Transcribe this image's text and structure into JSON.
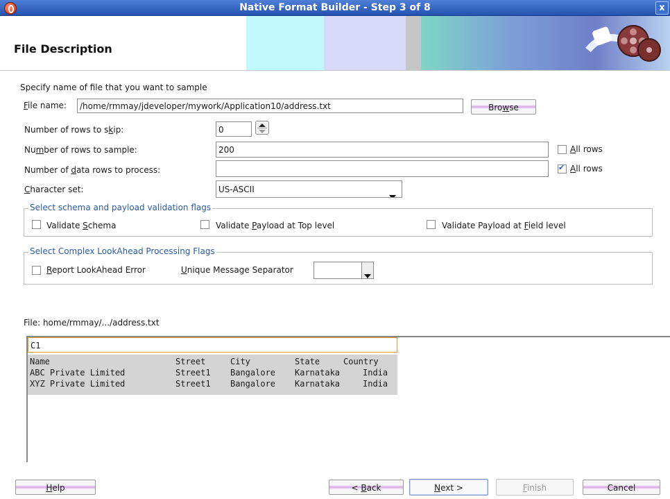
{
  "window": {
    "title": "Native Format Builder - Step 3 of 8",
    "close_label": "x"
  },
  "header": {
    "title": "File Description"
  },
  "form": {
    "intro": "Specify name of file that you want to sample",
    "file_name_label": "File name:",
    "file_name_value": "/home/rmmay/jdeveloper/mywork/Application10/address.txt",
    "browse_label": "Browse",
    "rows_to_skip_label": "Number of rows to skip:",
    "rows_to_skip_value": "0",
    "rows_to_sample_label": "Number of rows to sample:",
    "rows_to_sample_value": "200",
    "all_rows_label": "All rows",
    "all_rows_sample_checked": false,
    "data_rows_label": "Number of data rows to process:",
    "data_rows_value": "",
    "all_rows_process_checked": true,
    "charset_label": "Character set:",
    "charset_value": "US-ASCII"
  },
  "validation_group": {
    "title": "Select schema and payload validation flags",
    "validate_schema": "Validate Schema",
    "validate_top": "Validate Payload at Top level",
    "validate_field": "Validate Payload at Field level"
  },
  "lookahead_group": {
    "title": "Select Complex LookAhead Processing Flags",
    "report_error": "Report LookAhead Error",
    "separator_label": "Unique Message Separator",
    "separator_value": ""
  },
  "sample": {
    "file_label": "File: home/rmmay/.../address.txt",
    "column_name": "C1",
    "rows": [
      [
        "Name",
        "Street",
        "City",
        "State",
        "Country"
      ],
      [
        "ABC Private Limited",
        "Street1",
        "Bangalore",
        "Karnataka",
        "India"
      ],
      [
        "XYZ Private Limited",
        "Street1",
        "Bangalore",
        "Karnataka",
        "India"
      ]
    ]
  },
  "footer": {
    "help": "Help",
    "back": "< Back",
    "next": "Next >",
    "finish": "Finish",
    "cancel": "Cancel"
  },
  "colors": {
    "titlebar": "#2d5cbf",
    "group_title": "#2b5aa8",
    "selection": "#e59a2b"
  }
}
